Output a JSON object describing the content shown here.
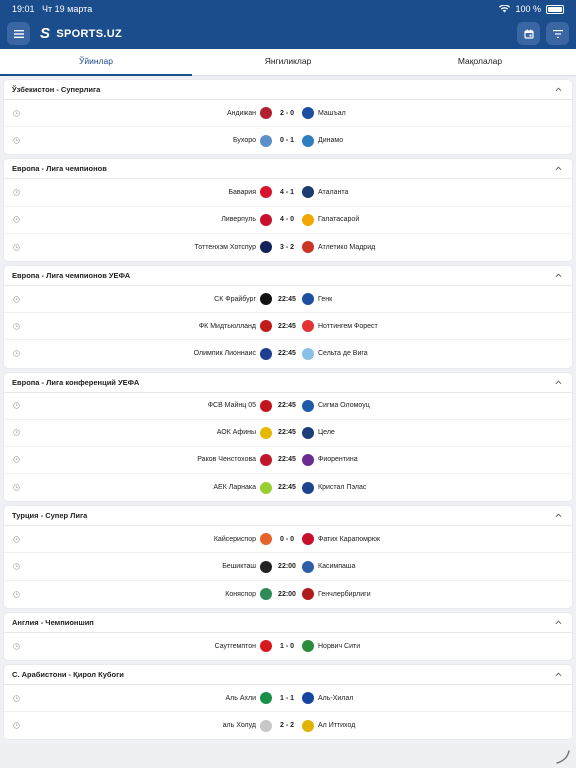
{
  "status": {
    "time": "19:01",
    "date": "Чт 19 марта",
    "battery": "100 %"
  },
  "app": {
    "brand": "SPORTS.UZ",
    "logo_letter": "S",
    "primary_color": "#1b4c8c"
  },
  "tabs": [
    {
      "label": "Ўйинлар",
      "active": true
    },
    {
      "label": "Янгиликлар",
      "active": false
    },
    {
      "label": "Мақолалар",
      "active": false
    }
  ],
  "sections": [
    {
      "title": "Ўзбекистон - Суперлига",
      "matches": [
        {
          "home": "Андижан",
          "score": "2 - 0",
          "away": "Машъал",
          "home_color": "#b21f2d",
          "away_color": "#1d4fa0"
        },
        {
          "home": "Бухоро",
          "score": "0 - 1",
          "away": "Динамо",
          "home_color": "#5f8fc9",
          "away_color": "#2e7fc2"
        }
      ]
    },
    {
      "title": "Европа - Лига чемпионов",
      "matches": [
        {
          "home": "Бавария",
          "score": "4 - 1",
          "away": "Аталанта",
          "home_color": "#d7142b",
          "away_color": "#1d3b6e"
        },
        {
          "home": "Ливерпуль",
          "score": "4 - 0",
          "away": "Галатасарой",
          "home_color": "#c8102e",
          "away_color": "#f2a800"
        },
        {
          "home": "Тоттенхэм Хотспур",
          "score": "3 - 2",
          "away": "Атлетико Мадрид",
          "home_color": "#132257",
          "away_color": "#cb3524"
        }
      ]
    },
    {
      "title": "Европа - Лига чемпионов УЕФА",
      "matches": [
        {
          "home": "СК Фрайбург",
          "score": "22:45",
          "away": "Генк",
          "home_color": "#111111",
          "away_color": "#1f4fa0"
        },
        {
          "home": "ФК Мидтьюлланд",
          "score": "22:45",
          "away": "Ноттингем Форест",
          "home_color": "#c01c1c",
          "away_color": "#e53233"
        },
        {
          "home": "Олимпик Лионнаис",
          "score": "22:45",
          "away": "Сельта де Вига",
          "home_color": "#1d3f8f",
          "away_color": "#8bc0e6"
        }
      ]
    },
    {
      "title": "Европа - Лига конференций УЕФА",
      "matches": [
        {
          "home": "ФСВ Майнц 05",
          "score": "22:45",
          "away": "Сигма Оломоуц",
          "home_color": "#c3141e",
          "away_color": "#1e5aa8"
        },
        {
          "home": "АОК Афины",
          "score": "22:45",
          "away": "Целе",
          "home_color": "#e6b800",
          "away_color": "#1c3d7a"
        },
        {
          "home": "Раков Ченстохова",
          "score": "22:45",
          "away": "Фиорентина",
          "home_color": "#c0182a",
          "away_color": "#6a2c91"
        },
        {
          "home": "АЕК Ларнака",
          "score": "22:45",
          "away": "Кристал Пэлас",
          "home_color": "#9acd32",
          "away_color": "#1b458f"
        }
      ]
    },
    {
      "title": "Турция - Супер Лига",
      "matches": [
        {
          "home": "Кайсериспор",
          "score": "0 - 0",
          "away": "Фатих Карагюмрюк",
          "home_color": "#e5642b",
          "away_color": "#c8102e"
        },
        {
          "home": "Бешикташ",
          "score": "22:00",
          "away": "Касимпаша",
          "home_color": "#222222",
          "away_color": "#2f5fa8"
        },
        {
          "home": "Коняспор",
          "score": "22:00",
          "away": "Генчлербирлиги",
          "home_color": "#2e8b57",
          "away_color": "#b01b1b"
        }
      ]
    },
    {
      "title": "Англия - Чемпионшип",
      "matches": [
        {
          "home": "Саутгемптон",
          "score": "1 - 0",
          "away": "Норвич Сити",
          "home_color": "#d71920",
          "away_color": "#2d8c3c"
        }
      ]
    },
    {
      "title": "С. Арабистони - Қирол Кубоги",
      "matches": [
        {
          "home": "Аль Ахли",
          "score": "1 - 1",
          "away": "Аль-Хилал",
          "home_color": "#1a8f4a",
          "away_color": "#1746a2"
        },
        {
          "home": "аль Холуд",
          "score": "2 - 2",
          "away": "Ал Иттиход",
          "home_color": "#c8c8c8",
          "away_color": "#e0b400"
        }
      ]
    }
  ]
}
